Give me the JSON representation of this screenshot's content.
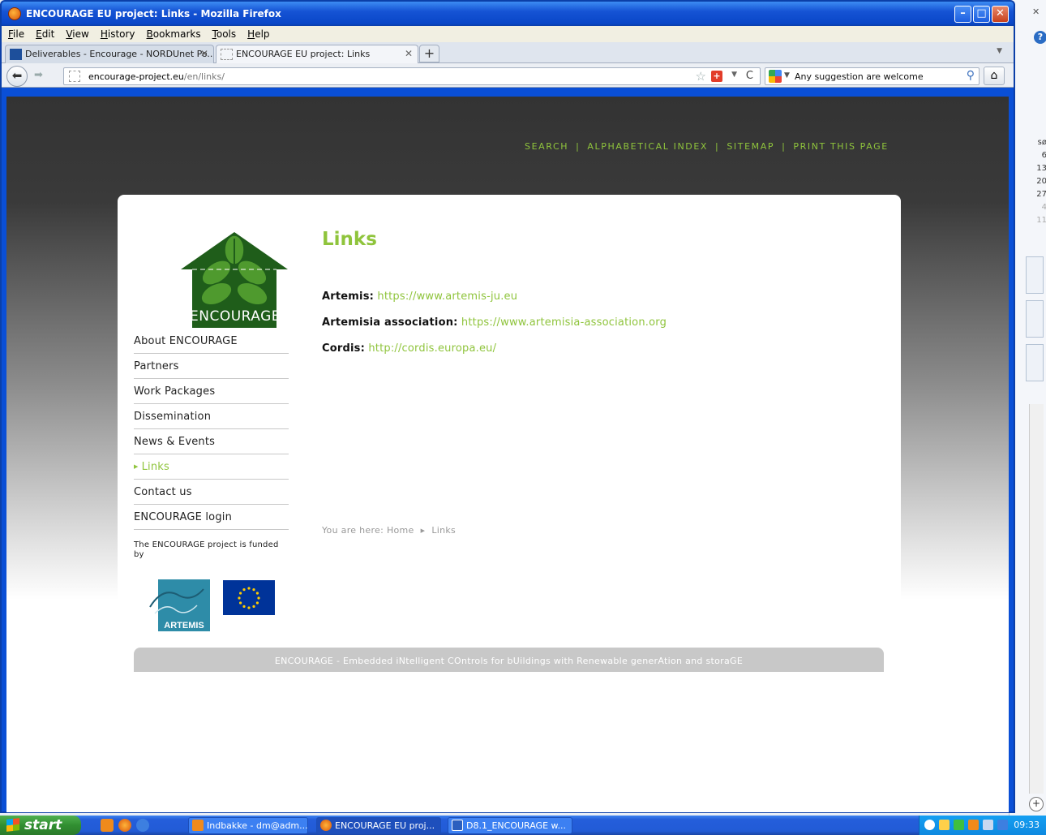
{
  "window": {
    "title": "ENCOURAGE EU project: Links - Mozilla Firefox"
  },
  "menu": [
    "File",
    "Edit",
    "View",
    "History",
    "Bookmarks",
    "Tools",
    "Help"
  ],
  "tabs": [
    {
      "label": "Deliverables - Encourage - NORDUnet Po...",
      "active": false
    },
    {
      "label": "ENCOURAGE EU project: Links",
      "active": true
    }
  ],
  "nav": {
    "url_host": "encourage-project.eu",
    "url_path": "/en/links/",
    "search_text": "Any suggestion are welcome"
  },
  "page": {
    "top_links": [
      "SEARCH",
      "ALPHABETICAL INDEX",
      "SITEMAP",
      "PRINT THIS PAGE"
    ],
    "top_sep": "|",
    "logo_text": "ENCOURAGE",
    "title": "Links",
    "sidebar": [
      {
        "label": "About ENCOURAGE",
        "active": false
      },
      {
        "label": "Partners",
        "active": false
      },
      {
        "label": "Work Packages",
        "active": false
      },
      {
        "label": "Dissemination",
        "active": false
      },
      {
        "label": "News & Events",
        "active": false
      },
      {
        "label": "Links",
        "active": true
      },
      {
        "label": "Contact us",
        "active": false
      },
      {
        "label": "ENCOURAGE login",
        "active": false
      }
    ],
    "funded_text": "The ENCOURAGE project is funded by",
    "artemis_text": "ARTEMIS",
    "links": [
      {
        "label": "Artemis:",
        "url": "https://www.artemis-ju.eu"
      },
      {
        "label": "Artemisia association:",
        "url": "https://www.artemisia-association.org"
      },
      {
        "label": "Cordis:",
        "url": "http://cordis.europa.eu/"
      }
    ],
    "breadcrumb": {
      "prefix": "You are here:",
      "home": "Home",
      "current": "Links"
    },
    "footer": "ENCOURAGE - Embedded iNtelligent COntrols for bUildings with Renewable generAtion and storaGE"
  },
  "bg_app": {
    "calendar": [
      "sø",
      "6",
      "13",
      "20",
      "27",
      "4",
      "11"
    ]
  },
  "taskbar": {
    "start": "start",
    "buttons": [
      {
        "label": "Indbakke - dm@adm....",
        "active": false
      },
      {
        "label": "ENCOURAGE EU proj...",
        "active": true
      },
      {
        "label": "D8.1_ENCOURAGE w...",
        "active": false
      }
    ],
    "clock": "09:33"
  },
  "colors": {
    "accent_green": "#8fc43c",
    "logo_green": "#1f5d1a",
    "xp_blue": "#245edb"
  }
}
